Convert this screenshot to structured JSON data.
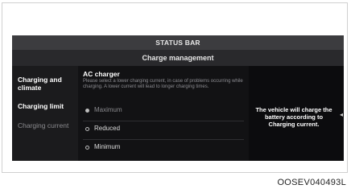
{
  "status_bar": {
    "label": "STATUS BAR"
  },
  "header": {
    "title": "Charge management"
  },
  "sidebar": {
    "items": [
      {
        "label": "Charging and climate"
      },
      {
        "label": "Charging limit"
      },
      {
        "label": "Charging current"
      }
    ]
  },
  "content": {
    "title": "AC charger",
    "description": "Please select a lower charging current, in case of problems occurring while charging. A lower current will lead to longer charging times.",
    "options": [
      {
        "label": "Maximum",
        "selected": true
      },
      {
        "label": "Reduced",
        "selected": false
      },
      {
        "label": "Minimum",
        "selected": false
      }
    ]
  },
  "info_panel": {
    "text": "The vehicle will charge the battery according to Charging current."
  },
  "caption": {
    "code": "OOSEV040493L"
  },
  "colors": {
    "screen_bg": "#0c0c0e",
    "status_bar_bg": "#3c3c3f",
    "header_bg": "#29292c",
    "sidebar_bg": "#1b1b1d"
  }
}
